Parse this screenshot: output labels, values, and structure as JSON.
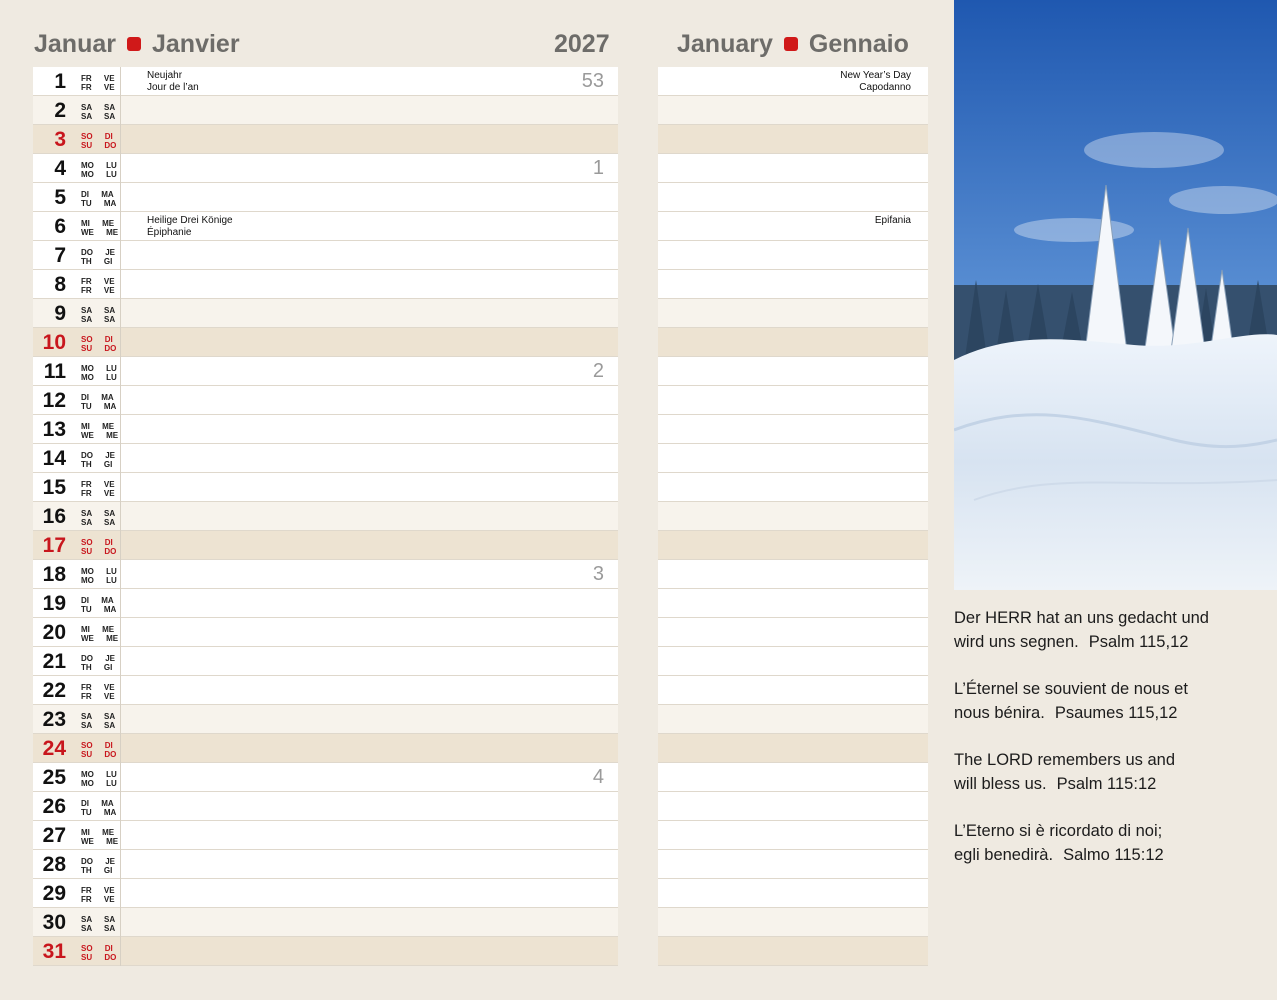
{
  "header": {
    "month_de": "Januar",
    "month_fr": "Janvier",
    "year": "2027",
    "month_en": "January",
    "month_it": "Gennaio"
  },
  "colors": {
    "accent_red": "#d01919",
    "sunday_red": "#c8161d",
    "sunday_row": "#ede3d2",
    "saturday_row": "#f7f3ec"
  },
  "days": [
    {
      "n": "1",
      "w1": "FR VE",
      "w2": "FR VE",
      "type": "wd",
      "wk": "53",
      "hol": [
        "Neujahr",
        "Jour de l’an"
      ],
      "hol_r": [
        "New Year’s Day",
        "Capodanno"
      ]
    },
    {
      "n": "2",
      "w1": "SA SA",
      "w2": "SA SA",
      "type": "sat"
    },
    {
      "n": "3",
      "w1": "SO DI",
      "w2": "SU DO",
      "type": "sun"
    },
    {
      "n": "4",
      "w1": "MO LU",
      "w2": "MO LU",
      "type": "wd",
      "wk": "1"
    },
    {
      "n": "5",
      "w1": "DI MA",
      "w2": "TU MA",
      "type": "wd"
    },
    {
      "n": "6",
      "w1": "MI ME",
      "w2": "WE ME",
      "type": "wd",
      "hol": [
        "Heilige Drei Könige",
        "Épiphanie"
      ],
      "hol_r": [
        "Epifania"
      ]
    },
    {
      "n": "7",
      "w1": "DO JE",
      "w2": "TH GI",
      "type": "wd"
    },
    {
      "n": "8",
      "w1": "FR VE",
      "w2": "FR VE",
      "type": "wd"
    },
    {
      "n": "9",
      "w1": "SA SA",
      "w2": "SA SA",
      "type": "sat"
    },
    {
      "n": "10",
      "w1": "SO DI",
      "w2": "SU DO",
      "type": "sun"
    },
    {
      "n": "11",
      "w1": "MO LU",
      "w2": "MO LU",
      "type": "wd",
      "wk": "2"
    },
    {
      "n": "12",
      "w1": "DI MA",
      "w2": "TU MA",
      "type": "wd"
    },
    {
      "n": "13",
      "w1": "MI ME",
      "w2": "WE ME",
      "type": "wd"
    },
    {
      "n": "14",
      "w1": "DO JE",
      "w2": "TH GI",
      "type": "wd"
    },
    {
      "n": "15",
      "w1": "FR VE",
      "w2": "FR VE",
      "type": "wd"
    },
    {
      "n": "16",
      "w1": "SA SA",
      "w2": "SA SA",
      "type": "sat"
    },
    {
      "n": "17",
      "w1": "SO DI",
      "w2": "SU DO",
      "type": "sun"
    },
    {
      "n": "18",
      "w1": "MO LU",
      "w2": "MO LU",
      "type": "wd",
      "wk": "3"
    },
    {
      "n": "19",
      "w1": "DI MA",
      "w2": "TU MA",
      "type": "wd"
    },
    {
      "n": "20",
      "w1": "MI ME",
      "w2": "WE ME",
      "type": "wd"
    },
    {
      "n": "21",
      "w1": "DO JE",
      "w2": "TH GI",
      "type": "wd"
    },
    {
      "n": "22",
      "w1": "FR VE",
      "w2": "FR VE",
      "type": "wd"
    },
    {
      "n": "23",
      "w1": "SA SA",
      "w2": "SA SA",
      "type": "sat"
    },
    {
      "n": "24",
      "w1": "SO DI",
      "w2": "SU DO",
      "type": "sun"
    },
    {
      "n": "25",
      "w1": "MO LU",
      "w2": "MO LU",
      "type": "wd",
      "wk": "4"
    },
    {
      "n": "26",
      "w1": "DI MA",
      "w2": "TU MA",
      "type": "wd"
    },
    {
      "n": "27",
      "w1": "MI ME",
      "w2": "WE ME",
      "type": "wd"
    },
    {
      "n": "28",
      "w1": "DO JE",
      "w2": "TH GI",
      "type": "wd"
    },
    {
      "n": "29",
      "w1": "FR VE",
      "w2": "FR VE",
      "type": "wd"
    },
    {
      "n": "30",
      "w1": "SA SA",
      "w2": "SA SA",
      "type": "sat"
    },
    {
      "n": "31",
      "w1": "SO DI",
      "w2": "SU DO",
      "type": "sun"
    }
  ],
  "verses": [
    {
      "line1": "Der HERR hat an uns gedacht und",
      "line2": "wird uns segnen.",
      "ref": "Psalm 115,12"
    },
    {
      "line1": "L’Éternel se souvient de nous et",
      "line2": "nous bénira.",
      "ref": "Psaumes 115,12"
    },
    {
      "line1": "The LORD remembers us and",
      "line2": "will bless us.",
      "ref": "Psalm 115:12"
    },
    {
      "line1": "L’Eterno si è ricordato di noi;",
      "line2": "egli benedirà.",
      "ref": "Salmo 115:12"
    }
  ]
}
